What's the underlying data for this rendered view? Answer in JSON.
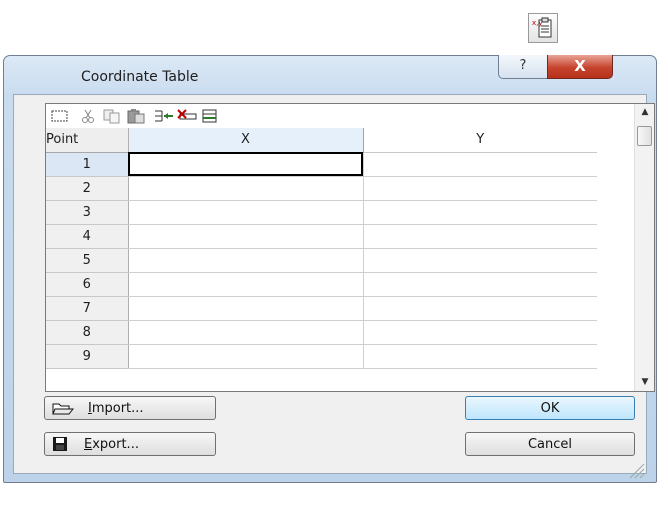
{
  "icons": {
    "top": "coordinate-table-icon",
    "select": "select-all-icon",
    "cut": "cut-icon",
    "copy": "copy-icon",
    "paste": "paste-icon",
    "insert_row": "insert-row-icon",
    "delete_row": "delete-row-icon",
    "append_row": "append-row-icon",
    "import": "open-folder-icon",
    "export": "save-disk-icon"
  },
  "window": {
    "title": "Coordinate Table",
    "help_glyph": "?",
    "close_glyph": "X"
  },
  "grid": {
    "headers": {
      "point": "Point",
      "x": "X",
      "y": "Y"
    },
    "rows": [
      {
        "point": "1",
        "x": "",
        "y": ""
      },
      {
        "point": "2",
        "x": "",
        "y": ""
      },
      {
        "point": "3",
        "x": "",
        "y": ""
      },
      {
        "point": "4",
        "x": "",
        "y": ""
      },
      {
        "point": "5",
        "x": "",
        "y": ""
      },
      {
        "point": "6",
        "x": "",
        "y": ""
      },
      {
        "point": "7",
        "x": "",
        "y": ""
      },
      {
        "point": "8",
        "x": "",
        "y": ""
      },
      {
        "point": "9",
        "x": "",
        "y": ""
      }
    ]
  },
  "buttons": {
    "import_rest": "mport...",
    "import_mnemonic": "I",
    "export_rest": "xport...",
    "export_mnemonic": "E",
    "ok": "OK",
    "cancel": "Cancel"
  },
  "colors": {
    "title_bar": "#c9dcef",
    "close": "#c6432c",
    "ok_button": "#bee6fd",
    "selected_cell_border": "#000000"
  }
}
